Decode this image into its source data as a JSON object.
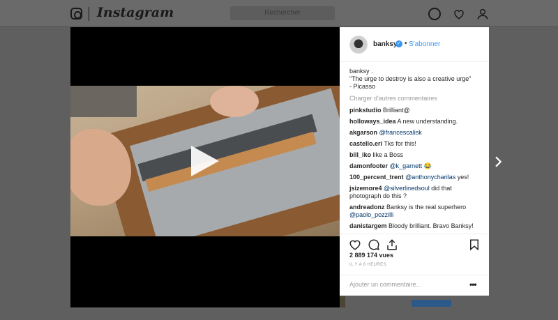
{
  "background": {
    "brand": "Instagram",
    "search_placeholder": "Rechercher",
    "icons": [
      "instagram-logo-icon",
      "compass-icon",
      "heart-icon",
      "profile-icon"
    ]
  },
  "post": {
    "username": "banksy",
    "verified": true,
    "separator": "•",
    "follow_label": "S'abonner",
    "caption_user": "banksy .",
    "caption_line1": "\"The urge to destroy is also a creative urge\"",
    "caption_line2": "- Picasso",
    "load_more": "Charger d'autres commentaires",
    "comments": [
      {
        "user": "pinkstudio",
        "text": "Brilliant@"
      },
      {
        "user": "holloways_idea",
        "text": "A new understanding."
      },
      {
        "user": "akgarson",
        "mention": "@francescalisk",
        "text": ""
      },
      {
        "user": "castello.eri",
        "text": "Tks for this!"
      },
      {
        "user": "bill_iko",
        "text": "like a Boss"
      },
      {
        "user": "damonfooter",
        "mention": "@k_garnett",
        "text": "😂"
      },
      {
        "user": "100_percent_trent",
        "mention": "@anthonycharilas",
        "text": "yes!"
      },
      {
        "user": "jsizemore4",
        "mention": "@silverlinedsoul",
        "text": "did that photograph do this ?"
      },
      {
        "user": "andreadonz",
        "text": "Banksy is the real superhero",
        "mention_after": "@paolo_pozzilli"
      },
      {
        "user": "danistargem",
        "text": "Bloody brilliant. Bravo Banksy!"
      }
    ],
    "views": "2 889 174 vues",
    "time": "IL Y A 6 HEURES",
    "add_comment_placeholder": "Ajouter un commentaire...",
    "more_label": "•••"
  },
  "colors": {
    "accent": "#3897f0",
    "mention": "#003569",
    "overlay": "#5f5f5f"
  }
}
